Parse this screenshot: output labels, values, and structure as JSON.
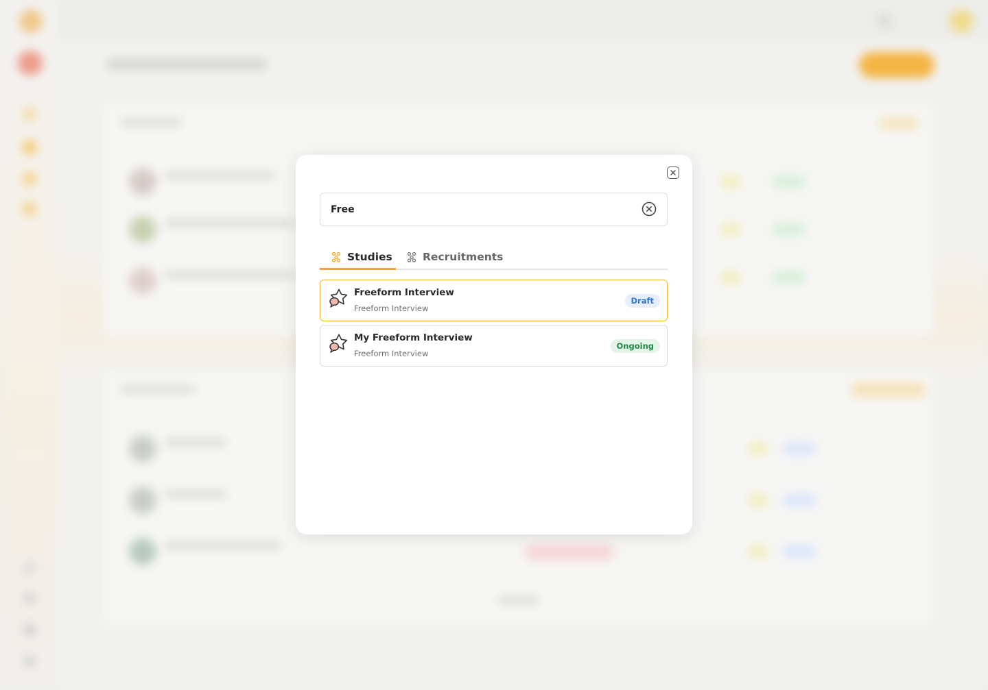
{
  "search": {
    "value": "Free",
    "clear_icon": "circle-x-icon"
  },
  "modal": {
    "close_icon": "close-x-icon"
  },
  "tabs": [
    {
      "label": "Studies",
      "icon": "people-network-icon",
      "active": true
    },
    {
      "label": "Recruitments",
      "icon": "people-network-icon",
      "active": false
    }
  ],
  "results": [
    {
      "title": "Freeform Interview",
      "subtitle": "Freeform Interview",
      "icon": "chat-star-icon",
      "status": "Draft",
      "status_color": "#2f74d0",
      "selected": true
    },
    {
      "title": "My Freeform Interview",
      "subtitle": "Freeform Interview",
      "icon": "chat-star-icon",
      "status": "Ongoing",
      "status_color": "#1f8a43",
      "selected": false
    }
  ],
  "colors": {
    "accent": "#f5a623",
    "selected_border": "#f5b334"
  }
}
